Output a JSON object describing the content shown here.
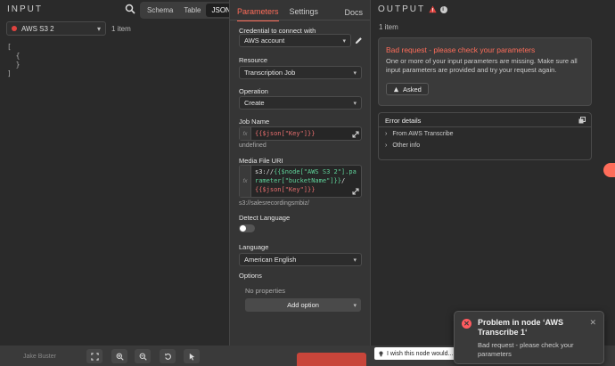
{
  "input": {
    "title": "INPUT",
    "view_tabs": [
      "Schema",
      "Table",
      "JSON"
    ],
    "active_view": "JSON",
    "node_name": "AWS S3 2",
    "item_count": "1 item",
    "json_lines": [
      "[",
      "  {",
      "  }",
      "]"
    ]
  },
  "params": {
    "tabs": [
      "Parameters",
      "Settings"
    ],
    "docs": "Docs",
    "credential_label": "Credential to connect with",
    "credential_value": "AWS account",
    "resource_label": "Resource",
    "resource_value": "Transcription Job",
    "operation_label": "Operation",
    "operation_value": "Create",
    "job_name_label": "Job Name",
    "job_name_expr": "{{$json[\"Key\"]}}",
    "job_name_hint": "undefined",
    "media_uri_label": "Media File URI",
    "media_uri_expr_prefix": "s3://",
    "media_uri_expr_part1": "{{$node[\"AWS S3 2\"].parameter[\"bucketName\"]}}",
    "media_uri_expr_sep": "/",
    "media_uri_expr_part2": "{{$json[\"Key\"]}}",
    "media_uri_hint": "s3://salesrecordingsmbiz/",
    "detect_language_label": "Detect Language",
    "detect_language_on": false,
    "language_label": "Language",
    "language_value": "American English",
    "options_label": "Options",
    "no_properties": "No properties",
    "add_option": "Add option"
  },
  "output": {
    "title": "OUTPUT",
    "item_count": "1 item",
    "error_title": "Bad request - please check your parameters",
    "error_message": "One or more of your input parameters are missing. Make sure all input parameters are provided and try your request again.",
    "asked_label": "Asked",
    "details_title": "Error details",
    "details_rows": [
      "From AWS Transcribe",
      "Other info"
    ]
  },
  "bottom": {
    "user_name": "Jake Buster",
    "feedback": "I wish this node would..."
  },
  "toast": {
    "title": "Problem in node ‘AWS Transcribe 1‘",
    "body": "Bad request - please check your parameters"
  },
  "colors": {
    "accent": "#ff6d5a",
    "error": "#e0433f",
    "panel_bg": "#353535"
  }
}
